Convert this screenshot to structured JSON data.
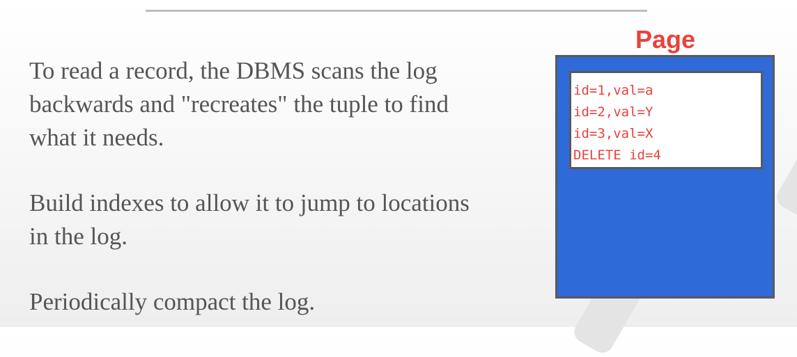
{
  "bullets": [
    "To read a record, the DBMS scans the log backwards and \"recreates\" the tuple to find what it needs.",
    "Build indexes to allow it to jump to locations in the log.",
    "Periodically compact the log."
  ],
  "page": {
    "title": "Page",
    "log_entries": [
      "id=1,val=a",
      "id=2,val=Y",
      "id=3,val=X",
      "DELETE id=4"
    ]
  }
}
